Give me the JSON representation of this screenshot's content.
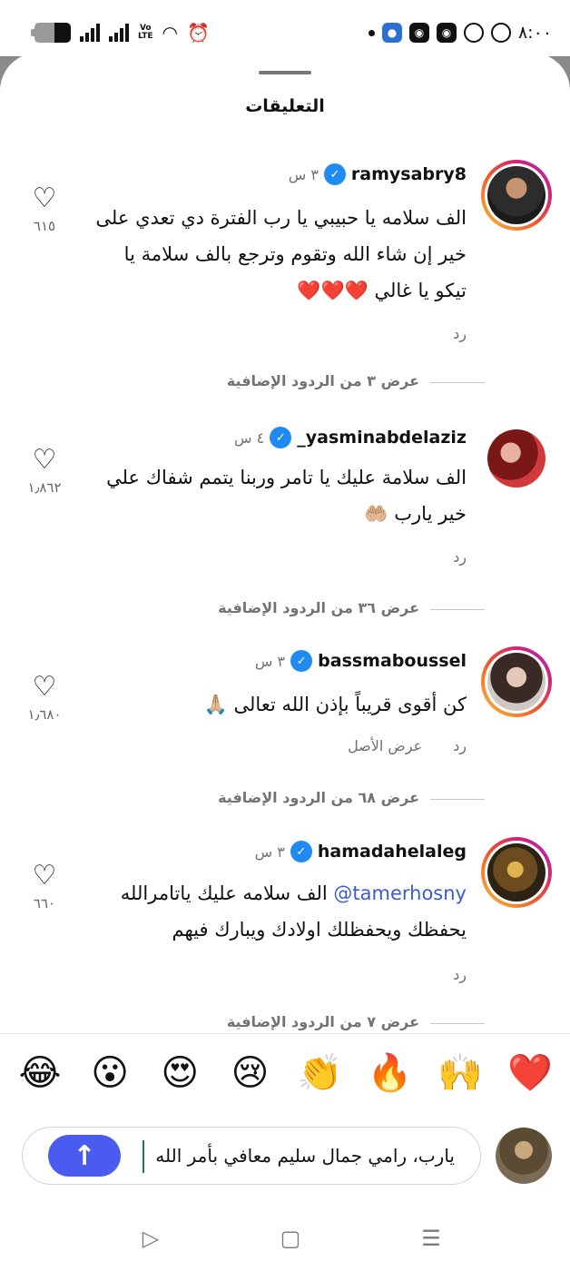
{
  "status_bar": {
    "volte": "Vo\nLTE",
    "time": "٨:٠٠"
  },
  "sheet": {
    "title": "التعليقات"
  },
  "comments": [
    {
      "username": "ramysabry8",
      "time": "٣ س",
      "text": "الف سلامه يا حبيبي يا رب الفترة دي تعدي على خير إن شاء الله وتقوم وترجع بالف سلامة يا تيكو يا غالي",
      "text_emoji": "❤️❤️❤️",
      "reply_label": "رد",
      "likes": "٦١٥",
      "more_replies": "عرض ٣ من الردود الإضافية"
    },
    {
      "username": "_yasminabdelaziz",
      "time": "٤ س",
      "text": "الف سلامة عليك يا تامر وربنا يتمم شفاك علي خير  يارب",
      "text_emoji": "🤲🏼",
      "reply_label": "رد",
      "likes": "١٫٨٦٢",
      "more_replies": "عرض ٣٦ من الردود الإضافية"
    },
    {
      "username": "bassmaboussel",
      "time": "٣ س",
      "text": "كن أقوى قريباً بإذن الله تعالى",
      "text_emoji": "🙏🏼",
      "reply_label": "رد",
      "see_original": "عرض الأصل",
      "likes": "١٫٦٨٠",
      "more_replies": "عرض ٦٨ من الردود الإضافية"
    },
    {
      "username": "hamadahelaleg",
      "time": "٣ س",
      "mention": "tamerhosny",
      "text": "الف سلامه عليك ياتامرالله يحفظك ويحفظلك اولادك ويبارك فيهم",
      "reply_label": "رد",
      "likes": "٦٦٠",
      "more_replies": "عرض ٧ من الردود الإضافية"
    }
  ],
  "emoji_bar": [
    "❤️",
    "🙌",
    "🔥",
    "👏",
    "😢",
    "😍",
    "😮",
    "😂"
  ],
  "input": {
    "value": "يارب، رامي جمال سليم معافي بأمر الله",
    "send_icon": "arrow-up-icon"
  },
  "nav": {
    "menu": "☰",
    "home": "▢",
    "back": "▷"
  }
}
